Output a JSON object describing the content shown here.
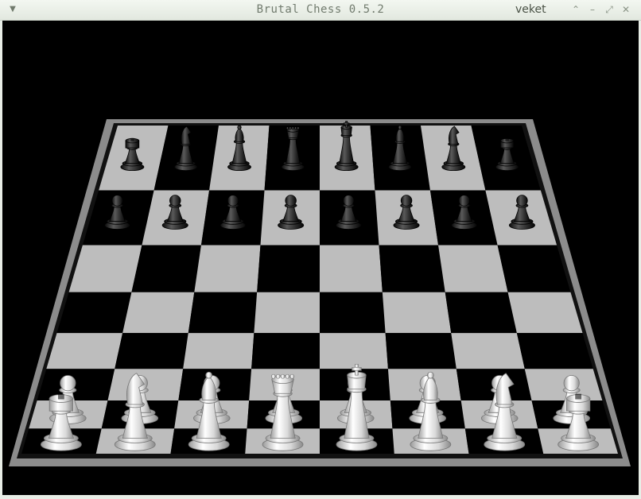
{
  "window": {
    "title": "Brutal Chess 0.5.2",
    "user": "veket",
    "menu_icon": "triangle-down-icon",
    "buttons": [
      "restore-icon",
      "minimize-icon",
      "maximize-icon",
      "close-icon"
    ]
  },
  "colors": {
    "light_square": "#bdbdbd",
    "dark_square": "#000000",
    "frame": "#8c8c8c",
    "white_piece": "#e6e6e6",
    "black_piece": "#2a2a2a"
  },
  "board": {
    "black_back_rank": [
      "rook",
      "knight",
      "bishop",
      "queen",
      "king",
      "bishop",
      "knight",
      "rook"
    ],
    "black_pawns": [
      "pawn",
      "pawn",
      "pawn",
      "pawn",
      "pawn",
      "pawn",
      "pawn",
      "pawn"
    ],
    "white_pawns": [
      "pawn",
      "pawn",
      "pawn",
      "pawn",
      "pawn",
      "pawn",
      "pawn",
      "pawn"
    ],
    "white_back_rank": [
      "rook",
      "knight",
      "bishop",
      "queen",
      "king",
      "bishop",
      "knight",
      "rook"
    ]
  }
}
